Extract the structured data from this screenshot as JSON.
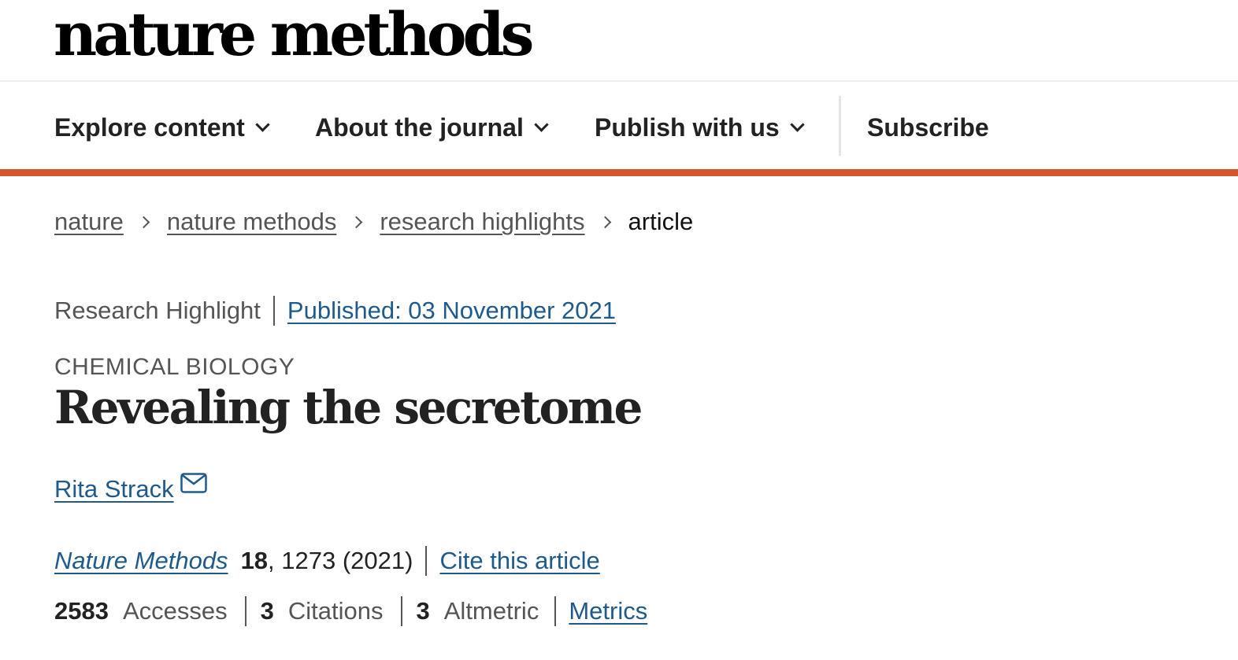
{
  "header": {
    "logo": "nature methods"
  },
  "nav": {
    "items": [
      {
        "label": "Explore content"
      },
      {
        "label": "About the journal"
      },
      {
        "label": "Publish with us"
      }
    ],
    "subscribe": "Subscribe",
    "accent_color": "#d4572c"
  },
  "breadcrumb": {
    "items": [
      "nature",
      "nature methods",
      "research highlights"
    ],
    "current": "article"
  },
  "article": {
    "type": "Research Highlight",
    "published": "Published: 03 November 2021",
    "subject": "CHEMICAL BIOLOGY",
    "title": "Revealing the secretome",
    "author": "Rita Strack",
    "author_icon": "mail-icon",
    "journal": "Nature Methods",
    "volume": "18",
    "pages": ", 1273 (2021)",
    "cite_label": "Cite this article",
    "link_color": "#1e5a8c"
  },
  "metrics": {
    "accesses_count": "2583",
    "accesses_label": "Accesses",
    "citations_count": "3",
    "citations_label": "Citations",
    "altmetric_count": "3",
    "altmetric_label": "Altmetric",
    "metrics_link": "Metrics"
  }
}
